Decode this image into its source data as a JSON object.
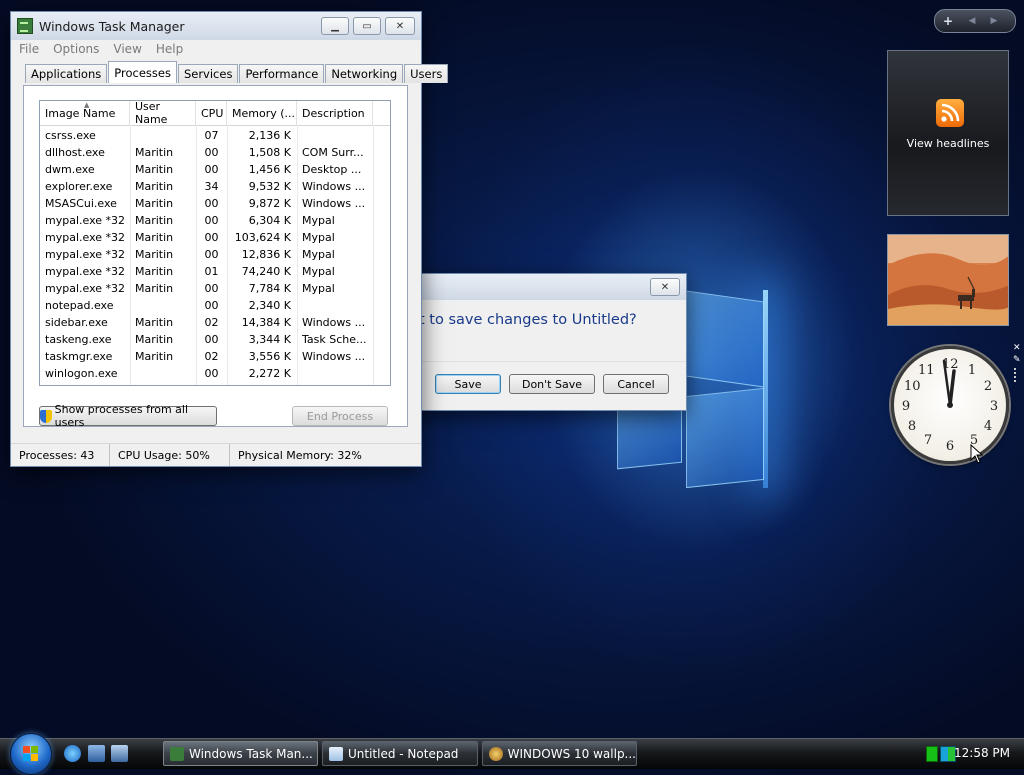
{
  "task_manager": {
    "title": "Windows Task Manager",
    "menu": [
      "File",
      "Options",
      "View",
      "Help"
    ],
    "tabs": [
      "Applications",
      "Processes",
      "Services",
      "Performance",
      "Networking",
      "Users"
    ],
    "active_tab": "Processes",
    "columns": [
      "Image Name",
      "User Name",
      "CPU",
      "Memory (...",
      "Description"
    ],
    "rows": [
      {
        "name": "csrss.exe",
        "user": "",
        "cpu": "07",
        "mem": "2,136 K",
        "desc": ""
      },
      {
        "name": "dllhost.exe",
        "user": "Maritin",
        "cpu": "00",
        "mem": "1,508 K",
        "desc": "COM Surr..."
      },
      {
        "name": "dwm.exe",
        "user": "Maritin",
        "cpu": "00",
        "mem": "1,456 K",
        "desc": "Desktop ..."
      },
      {
        "name": "explorer.exe",
        "user": "Maritin",
        "cpu": "34",
        "mem": "9,532 K",
        "desc": "Windows ..."
      },
      {
        "name": "MSASCui.exe",
        "user": "Maritin",
        "cpu": "00",
        "mem": "9,872 K",
        "desc": "Windows ..."
      },
      {
        "name": "mypal.exe *32",
        "user": "Maritin",
        "cpu": "00",
        "mem": "6,304 K",
        "desc": "Mypal"
      },
      {
        "name": "mypal.exe *32",
        "user": "Maritin",
        "cpu": "00",
        "mem": "103,624 K",
        "desc": "Mypal"
      },
      {
        "name": "mypal.exe *32",
        "user": "Maritin",
        "cpu": "00",
        "mem": "12,836 K",
        "desc": "Mypal"
      },
      {
        "name": "mypal.exe *32",
        "user": "Maritin",
        "cpu": "01",
        "mem": "74,240 K",
        "desc": "Mypal"
      },
      {
        "name": "mypal.exe *32",
        "user": "Maritin",
        "cpu": "00",
        "mem": "7,784 K",
        "desc": "Mypal"
      },
      {
        "name": "notepad.exe",
        "user": "",
        "cpu": "00",
        "mem": "2,340 K",
        "desc": ""
      },
      {
        "name": "sidebar.exe",
        "user": "Maritin",
        "cpu": "02",
        "mem": "14,384 K",
        "desc": "Windows ..."
      },
      {
        "name": "taskeng.exe",
        "user": "Maritin",
        "cpu": "00",
        "mem": "3,344 K",
        "desc": "Task Sche..."
      },
      {
        "name": "taskmgr.exe",
        "user": "Maritin",
        "cpu": "02",
        "mem": "3,556 K",
        "desc": "Windows ..."
      },
      {
        "name": "winlogon.exe",
        "user": "",
        "cpu": "00",
        "mem": "2,272 K",
        "desc": ""
      }
    ],
    "show_all_label": "Show processes from all users",
    "end_process_label": "End Process",
    "status": {
      "processes": "Processes: 43",
      "cpu": "CPU Usage: 50%",
      "memory": "Physical Memory: 32%"
    }
  },
  "dialog": {
    "message": "t to save changes to Untitled?",
    "save": "Save",
    "dont_save": "Don't Save",
    "cancel": "Cancel"
  },
  "taskbar": {
    "buttons": [
      "Windows Task Man...",
      "Untitled - Notepad",
      "WINDOWS 10 wallp..."
    ],
    "time": "12:58 PM"
  },
  "gadgets": {
    "control_plus": "+",
    "feed_text": "View headlines",
    "clock_numbers": [
      "12",
      "1",
      "2",
      "3",
      "4",
      "5",
      "6",
      "7",
      "8",
      "9",
      "10",
      "11"
    ]
  },
  "colors": {
    "accent_blue": "#1e68c8",
    "dialog_text": "#1a3a8a",
    "rss_orange": "#ee6a07"
  }
}
